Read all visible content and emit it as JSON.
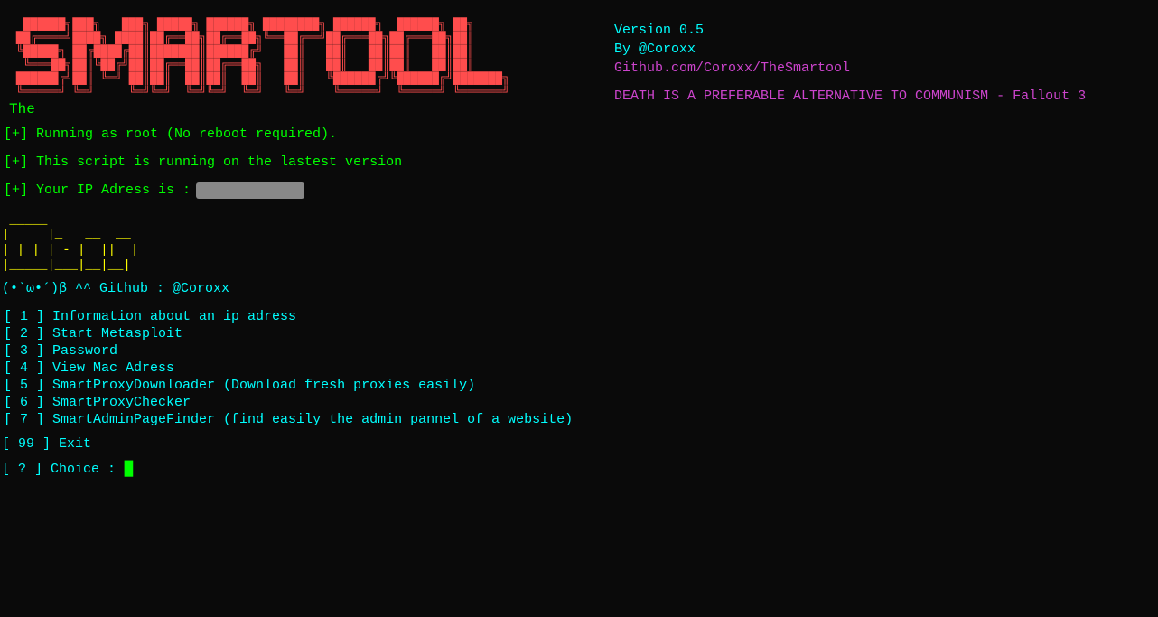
{
  "header": {
    "version": "Version 0.5",
    "author": "By @Coroxx",
    "github": "Github.com/Coroxx/TheSmartool",
    "quote": "DEATH IS A PREFERABLE ALTERNATIVE TO COMMUNISM - Fallout 3",
    "the_label": "The"
  },
  "logo": {
    "ascii_art": " ____  __  __    _    ____  _____ ___   ___  _     \n/ ___||  \\/  |  / \\  |  _ \\|_   _/ _ \\ / _ \\| |    \n\\___ \\| |\\/| | / _ \\ | |_) | | || | | | | | | |    \n ___) | |  | |/ ___ \\|  _ <  | || |_| | |_| | |___ \n|____/|_|  |_/_/   \\_\\_| \\_\\ |_| \\___/ \\___/|_____|"
  },
  "status": {
    "root_message": "[+] Running as root (No reboot required).",
    "version_message": "[+] This script is running on the lastest version",
    "ip_label": "[+] Your IP Adress is :"
  },
  "ascii_face": "(•`ω•´)β ^^  Github : @Coroxx",
  "menu": {
    "items": [
      {
        "number": "1",
        "label": "Information about an ip adress"
      },
      {
        "number": "2",
        "label": "Start Metasploit"
      },
      {
        "number": "3",
        "label": "Password"
      },
      {
        "number": "4",
        "label": "View Mac Adress"
      },
      {
        "number": "5",
        "label": "SmartProxyDownloader (Download fresh proxies easily)"
      },
      {
        "number": "6",
        "label": "SmartProxyChecker"
      },
      {
        "number": "7",
        "label": "SmartAdminPageFinder (find easily the admin pannel of a website)"
      }
    ],
    "exit_number": "99",
    "exit_label": "Exit"
  },
  "choice": {
    "prompt": "[ ? ] Choice :"
  }
}
